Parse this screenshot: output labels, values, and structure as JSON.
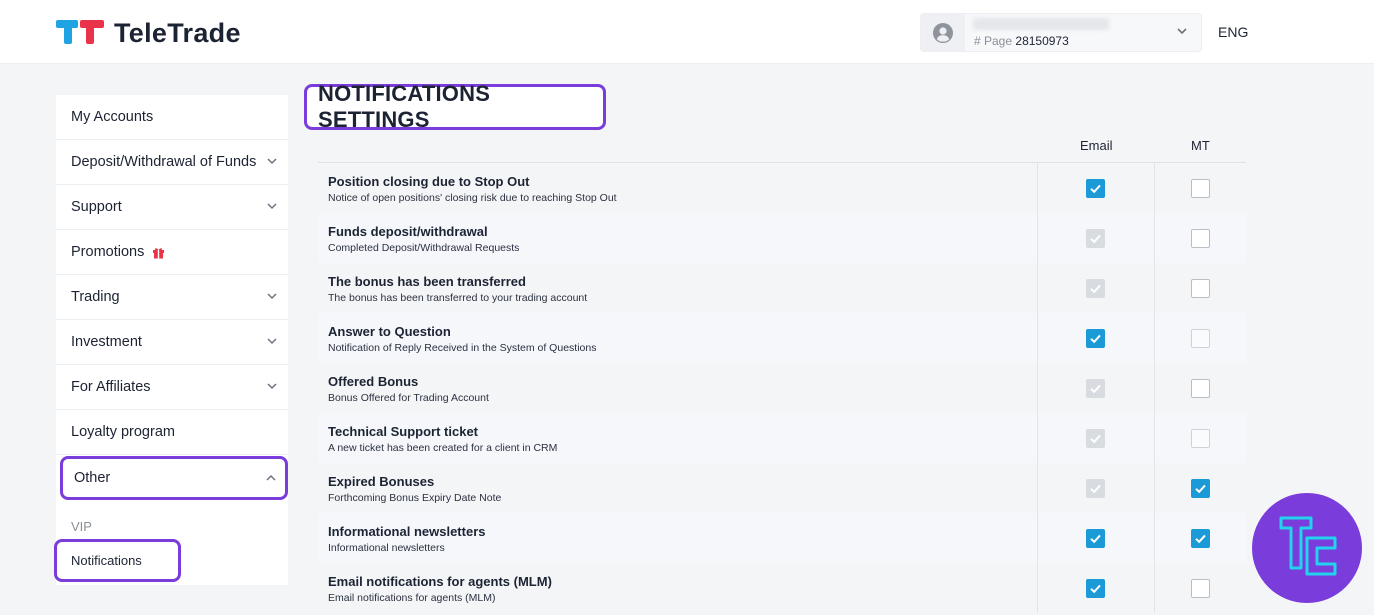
{
  "header": {
    "brand": "TeleTrade",
    "account": {
      "page_prefix": "# Page",
      "page_number": "28150973"
    },
    "language": "ENG"
  },
  "sidebar": {
    "items": [
      {
        "label": "My Accounts"
      },
      {
        "label": "Deposit/Withdrawal of Funds"
      },
      {
        "label": "Support"
      },
      {
        "label": "Promotions"
      },
      {
        "label": "Trading"
      },
      {
        "label": "Investment"
      },
      {
        "label": "For Affiliates"
      },
      {
        "label": "Loyalty program"
      }
    ],
    "other": {
      "label": "Other"
    },
    "sub_items": [
      {
        "label": "VIP"
      },
      {
        "label": "Notifications"
      }
    ]
  },
  "main": {
    "title": "NOTIFICATIONS SETTINGS",
    "columns": {
      "email": "Email",
      "mt": "MT"
    },
    "rows": [
      {
        "name": "Position closing due to Stop Out",
        "desc": "Notice of open positions' closing risk due to reaching Stop Out",
        "email": "checked",
        "mt": "unchecked"
      },
      {
        "name": "Funds deposit/withdrawal",
        "desc": "Completed Deposit/Withdrawal Requests",
        "email": "checked-disabled",
        "mt": "unchecked"
      },
      {
        "name": "The bonus has been transferred",
        "desc": "The bonus has been transferred to your trading account",
        "email": "checked-disabled",
        "mt": "unchecked"
      },
      {
        "name": "Answer to Question",
        "desc": "Notification of Reply Received in the System of Questions",
        "email": "checked",
        "mt": "unchecked-disabled"
      },
      {
        "name": "Offered Bonus",
        "desc": "Bonus Offered for Trading Account",
        "email": "checked-disabled",
        "mt": "unchecked"
      },
      {
        "name": "Technical Support ticket",
        "desc": "A new ticket has been created for a client in CRM",
        "email": "checked-disabled",
        "mt": "unchecked-disabled"
      },
      {
        "name": "Expired Bonuses",
        "desc": "Forthcoming Bonus Expiry Date Note",
        "email": "checked-disabled",
        "mt": "checked"
      },
      {
        "name": "Informational newsletters",
        "desc": "Informational newsletters",
        "email": "checked",
        "mt": "checked"
      },
      {
        "name": "Email notifications for agents (MLM)",
        "desc": "Email notifications for agents (MLM)",
        "email": "checked",
        "mt": "unchecked"
      }
    ]
  },
  "colors": {
    "accent_purple": "#7a3ddb",
    "checkbox_blue": "#1a9ad6",
    "logo_blue": "#1fa3e2",
    "logo_red": "#e8334a"
  }
}
